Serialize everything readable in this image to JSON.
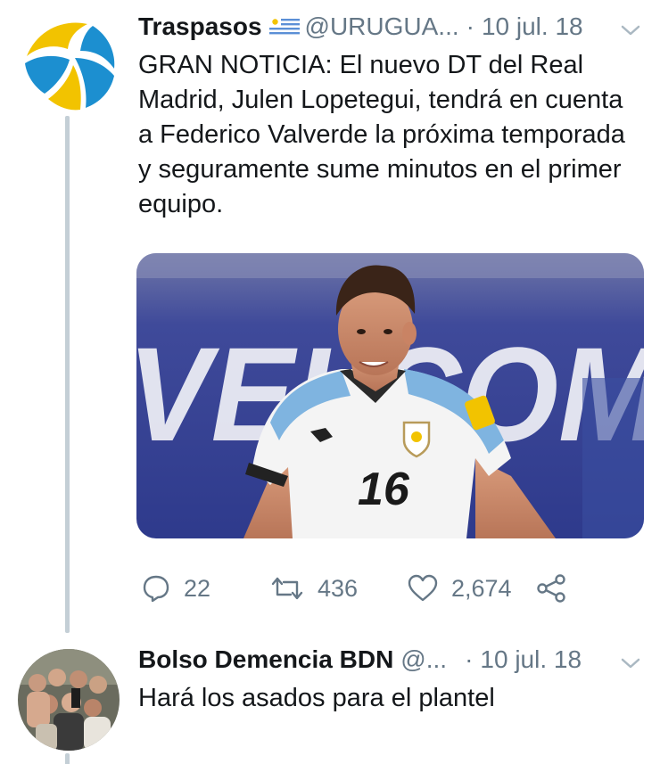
{
  "colors": {
    "text": "#14171a",
    "secondary": "#657786",
    "thread_line": "#c4cfd6",
    "logo_yellow": "#f2c300",
    "logo_blue": "#1c8fd0"
  },
  "tweet1": {
    "name": "Traspasos",
    "flag_icon": "uruguay-flag",
    "handle": "@URUGUA...",
    "separator": "·",
    "date": "10 jul. 18",
    "text": "GRAN NOTICIA: El nuevo DT del Real Madrid, Julen Lopetegui, tendrá en cuenta a Federico Valverde la próxima temporada y seguramente sume minutos en el primer equipo.",
    "media": {
      "jersey_number": "16",
      "background_text": "VELCOM"
    },
    "actions": {
      "reply_icon": "reply-icon",
      "reply_count": "22",
      "retweet_icon": "retweet-icon",
      "retweet_count": "436",
      "like_icon": "heart-icon",
      "like_count": "2,674",
      "share_icon": "share-icon"
    }
  },
  "tweet2": {
    "name": "Bolso Demencia BDN",
    "handle": "@...",
    "separator": "·",
    "date": "10 jul. 18",
    "text": "Hará los asados para el plantel"
  }
}
